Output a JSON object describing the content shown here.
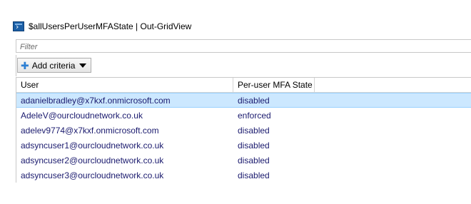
{
  "window": {
    "title": "$allUsersPerUserMFAState | Out-GridView"
  },
  "filter": {
    "placeholder": "Filter"
  },
  "criteria": {
    "add_label": "Add criteria"
  },
  "table": {
    "columns": [
      "User",
      "Per-user MFA State"
    ],
    "rows": [
      {
        "user": "adanielbradley@x7kxf.onmicrosoft.com",
        "state": "disabled",
        "selected": true
      },
      {
        "user": "AdeleV@ourcloudnetwork.co.uk",
        "state": "enforced",
        "selected": false
      },
      {
        "user": "adelev9774@x7kxf.onmicrosoft.com",
        "state": "disabled",
        "selected": false
      },
      {
        "user": "adsyncuser1@ourcloudnetwork.co.uk",
        "state": "disabled",
        "selected": false
      },
      {
        "user": "adsyncuser2@ourcloudnetwork.co.uk",
        "state": "disabled",
        "selected": false
      },
      {
        "user": "adsyncuser3@ourcloudnetwork.co.uk",
        "state": "disabled",
        "selected": false
      }
    ]
  },
  "colors": {
    "selection": "#cce8ff",
    "accent": "#2d7fd3",
    "text": "#1a1a6e"
  },
  "icons": {
    "app": "powershell-icon",
    "add": "plus-icon",
    "dropdown": "caret-down-icon"
  }
}
